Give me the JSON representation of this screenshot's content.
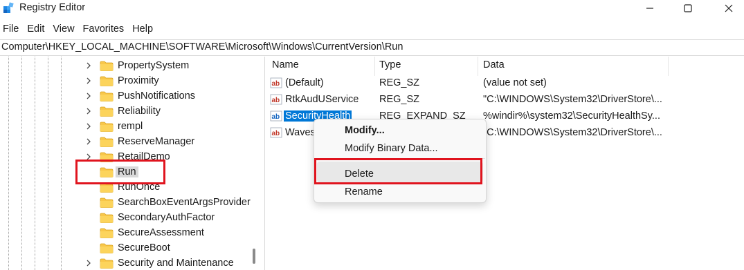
{
  "window": {
    "title": "Registry Editor",
    "controls": [
      "minimize",
      "maximize",
      "close"
    ]
  },
  "menu": [
    "File",
    "Edit",
    "View",
    "Favorites",
    "Help"
  ],
  "address": "Computer\\HKEY_LOCAL_MACHINE\\SOFTWARE\\Microsoft\\Windows\\CurrentVersion\\Run",
  "tree": {
    "items": [
      {
        "label": "PropertySystem",
        "expandable": true
      },
      {
        "label": "Proximity",
        "expandable": true
      },
      {
        "label": "PushNotifications",
        "expandable": true
      },
      {
        "label": "Reliability",
        "expandable": true
      },
      {
        "label": "rempl",
        "expandable": true
      },
      {
        "label": "ReserveManager",
        "expandable": true
      },
      {
        "label": "RetailDemo",
        "expandable": true
      },
      {
        "label": "Run",
        "expandable": false,
        "selected": true
      },
      {
        "label": "RunOnce",
        "expandable": false
      },
      {
        "label": "SearchBoxEventArgsProvider",
        "expandable": false
      },
      {
        "label": "SecondaryAuthFactor",
        "expandable": false
      },
      {
        "label": "SecureAssessment",
        "expandable": false
      },
      {
        "label": "SecureBoot",
        "expandable": false
      },
      {
        "label": "Security and Maintenance",
        "expandable": true
      }
    ]
  },
  "list": {
    "columns": [
      "Name",
      "Type",
      "Data"
    ],
    "rows": [
      {
        "name": "(Default)",
        "type": "REG_SZ",
        "data": "(value not set)"
      },
      {
        "name": "RtkAudUService",
        "type": "REG_SZ",
        "data": "\"C:\\WINDOWS\\System32\\DriverStore\\..."
      },
      {
        "name": "SecurityHealth",
        "type": "REG_EXPAND_SZ",
        "data": "%windir%\\system32\\SecurityHealthSy...",
        "selected": true
      },
      {
        "name": "Waves",
        "type": "",
        "data": "\"C:\\WINDOWS\\System32\\DriverStore\\..."
      }
    ]
  },
  "context_menu": {
    "items": [
      {
        "label": "Modify...",
        "bold": true
      },
      {
        "label": "Modify Binary Data..."
      },
      {
        "label": "Delete",
        "hovered": true
      },
      {
        "label": "Rename"
      }
    ]
  },
  "colors": {
    "highlight": "#e0141e",
    "selection": "#0078d7",
    "folder": "#f8c74a"
  }
}
